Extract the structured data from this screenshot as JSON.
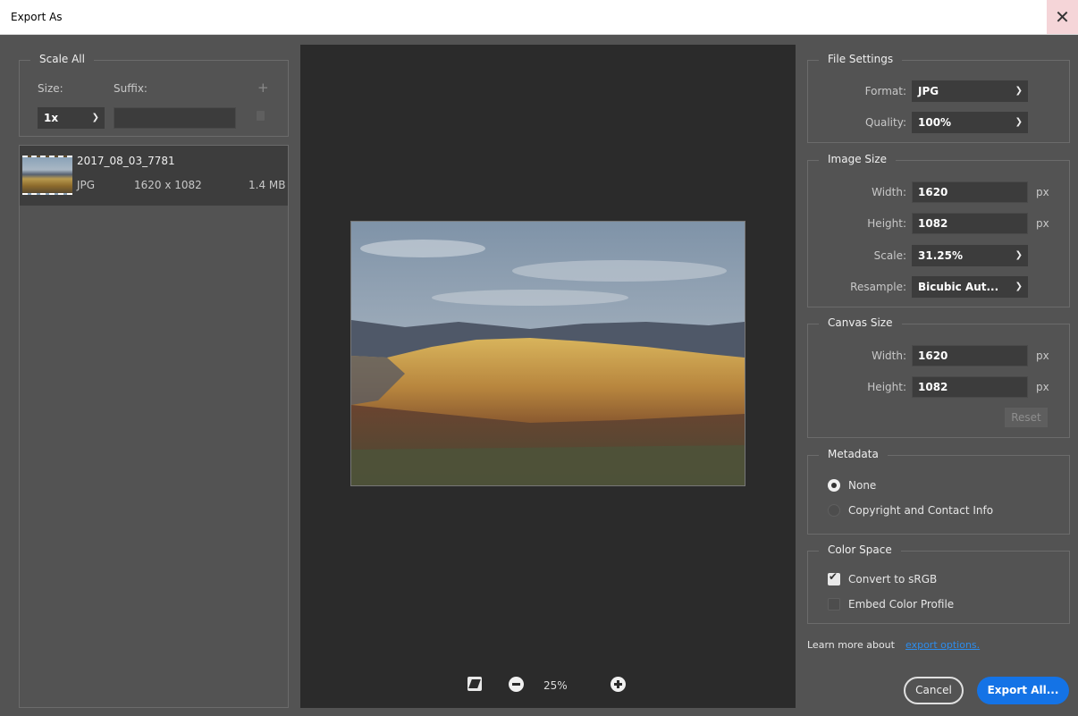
{
  "window": {
    "title": "Export As",
    "close_glyph": "✕"
  },
  "scale_all": {
    "legend": "Scale All",
    "size_label": "Size:",
    "suffix_label": "Suffix:",
    "size_value": "1x",
    "suffix_value": "",
    "add_glyph": "+",
    "delete_glyph": "🗑"
  },
  "asset": {
    "name": "2017_08_03_7781",
    "format": "JPG",
    "dimensions": "1620 x 1082",
    "filesize": "1.4 MB"
  },
  "preview": {
    "zoom": "25%"
  },
  "file_settings": {
    "legend": "File Settings",
    "format_label": "Format:",
    "format_value": "JPG",
    "quality_label": "Quality:",
    "quality_value": "100%"
  },
  "image_size": {
    "legend": "Image Size",
    "width_label": "Width:",
    "width_value": "1620",
    "height_label": "Height:",
    "height_value": "1082",
    "unit": "px",
    "scale_label": "Scale:",
    "scale_value": "31.25%",
    "resample_label": "Resample:",
    "resample_value": "Bicubic Aut..."
  },
  "canvas_size": {
    "legend": "Canvas Size",
    "width_label": "Width:",
    "width_value": "1620",
    "height_label": "Height:",
    "height_value": "1082",
    "unit": "px",
    "reset_label": "Reset"
  },
  "metadata": {
    "legend": "Metadata",
    "options": [
      "None",
      "Copyright and Contact Info"
    ],
    "selected": "None"
  },
  "color_space": {
    "legend": "Color Space",
    "convert_label": "Convert to sRGB",
    "convert_checked": true,
    "embed_label": "Embed Color Profile",
    "embed_checked": false
  },
  "footer": {
    "learn_text": "Learn more about",
    "learn_link": "export options.",
    "cancel_label": "Cancel",
    "export_label": "Export All..."
  },
  "colors": {
    "accent": "#1473e6",
    "link": "#2d8ceb",
    "panel_bg": "#535353",
    "preview_bg": "#2b2b2b"
  }
}
